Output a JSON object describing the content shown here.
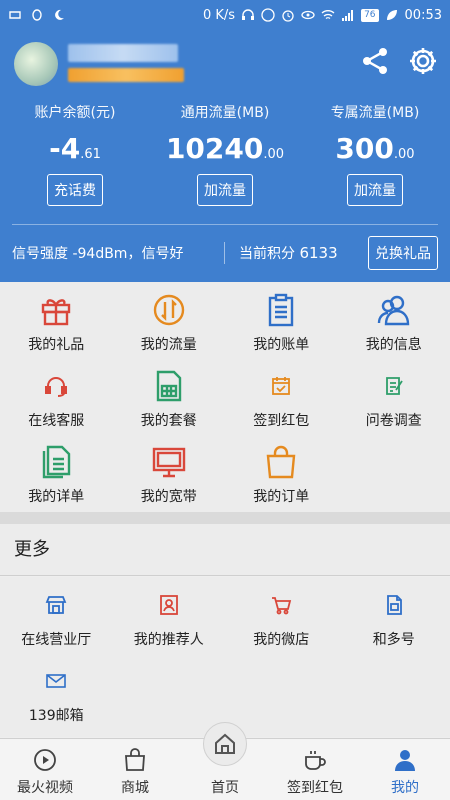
{
  "status_bar": {
    "speed": "0 K/s",
    "battery": "76",
    "time": "00:53"
  },
  "header": {
    "balance_label": "账户余额(元)",
    "balance_main": "-4",
    "balance_decimal": ".61",
    "general_flow_label": "通用流量(MB)",
    "general_flow_main": "10240",
    "general_flow_decimal": ".00",
    "special_flow_label": "专属流量(MB)",
    "special_flow_main": "300",
    "special_flow_decimal": ".00",
    "recharge_button": "充话费",
    "add_flow_button_1": "加流量",
    "add_flow_button_2": "加流量",
    "signal_label": "信号强度",
    "signal_value": "-94dBm，信号好",
    "points_label": "当前积分",
    "points_value": "6133",
    "exchange_button": "兑换礼品"
  },
  "grid_items": [
    {
      "label": "我的礼品",
      "icon": "gift-icon"
    },
    {
      "label": "我的流量",
      "icon": "flow-icon"
    },
    {
      "label": "我的账单",
      "icon": "bill-icon"
    },
    {
      "label": "我的信息",
      "icon": "user-info-icon"
    },
    {
      "label": "在线客服",
      "icon": "headset-icon"
    },
    {
      "label": "我的套餐",
      "icon": "sim-card-icon"
    },
    {
      "label": "签到红包",
      "icon": "calendar-check-icon"
    },
    {
      "label": "问卷调查",
      "icon": "survey-icon"
    },
    {
      "label": "我的详单",
      "icon": "document-icon"
    },
    {
      "label": "我的宽带",
      "icon": "monitor-icon"
    },
    {
      "label": "我的订单",
      "icon": "shopping-bag-icon"
    }
  ],
  "more_title": "更多",
  "more_items": [
    {
      "label": "在线营业厅",
      "icon": "store-icon"
    },
    {
      "label": "我的推荐人",
      "icon": "referrer-icon"
    },
    {
      "label": "我的微店",
      "icon": "cart-icon"
    },
    {
      "label": "和多号",
      "icon": "multi-number-icon"
    },
    {
      "label": "139邮箱",
      "icon": "mail-icon"
    }
  ],
  "bottom_nav": [
    {
      "label": "最火视频",
      "icon": "play-icon"
    },
    {
      "label": "商城",
      "icon": "shop-bag-icon"
    },
    {
      "label": "首页",
      "icon": "home-icon"
    },
    {
      "label": "签到红包",
      "icon": "coffee-icon"
    },
    {
      "label": "我的",
      "icon": "person-icon",
      "active": true
    }
  ],
  "colors": {
    "primary": "#3f7fcf",
    "active_nav": "#2f6fc8",
    "red": "#d9473a",
    "orange": "#e58a1f",
    "blue": "#2f6fc8",
    "green": "#2e9e6a"
  }
}
